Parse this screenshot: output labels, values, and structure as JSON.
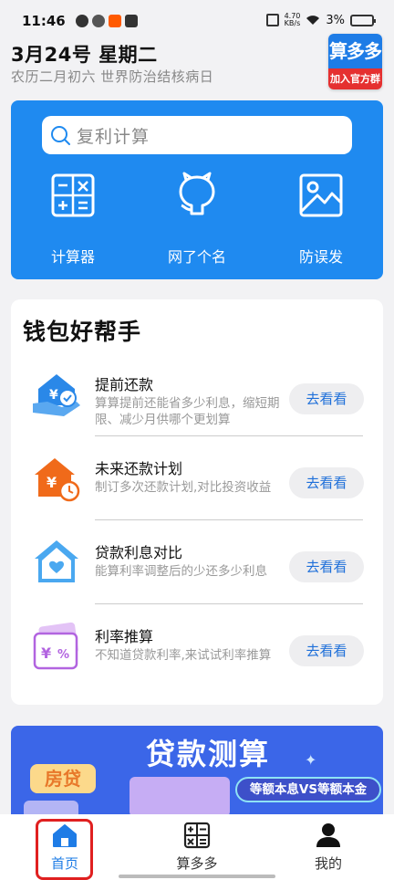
{
  "status_bar": {
    "time": "11:46",
    "net_speed_value": "4.70",
    "net_speed_unit": "KB/s",
    "battery": "3%"
  },
  "header": {
    "date": "3月24号 星期二",
    "lunar": "农历二月初六 世界防治结核病日",
    "brand_top": "算多多",
    "brand_bottom": "加入官方群"
  },
  "search": {
    "placeholder": "复利计算"
  },
  "tools": [
    {
      "label": "计算器",
      "icon": "calculator-icon"
    },
    {
      "label": "网了个名",
      "icon": "github-icon"
    },
    {
      "label": "防误发",
      "icon": "image-icon"
    }
  ],
  "wallet": {
    "title": "钱包好帮手",
    "items": [
      {
        "title": "提前还款",
        "desc": "算算提前还能省多少利息，缩短期限、减少月供哪个更划算",
        "button": "去看看",
        "icon": "prepay-icon"
      },
      {
        "title": "未来还款计划",
        "desc": "制订多次还款计划,对比投资收益",
        "button": "去看看",
        "icon": "repay-plan-icon"
      },
      {
        "title": "贷款利息对比",
        "desc": "能算利率调整后的少还多少利息",
        "button": "去看看",
        "icon": "house-heart-icon"
      },
      {
        "title": "利率推算",
        "desc": "不知道贷款利率,来试试利率推算",
        "button": "去看看",
        "icon": "rate-icon"
      }
    ]
  },
  "banner": {
    "title": "贷款测算",
    "tag": "房贷",
    "compare": "等额本息VS等额本金"
  },
  "bottom_nav": [
    {
      "label": "首页",
      "icon": "home-icon",
      "active": true
    },
    {
      "label": "算多多",
      "icon": "calculator-icon",
      "active": false
    },
    {
      "label": "我的",
      "icon": "person-icon",
      "active": false
    }
  ],
  "colors": {
    "accent": "#1f8af0",
    "link": "#1e6fd9",
    "highlight": "#e02020"
  }
}
